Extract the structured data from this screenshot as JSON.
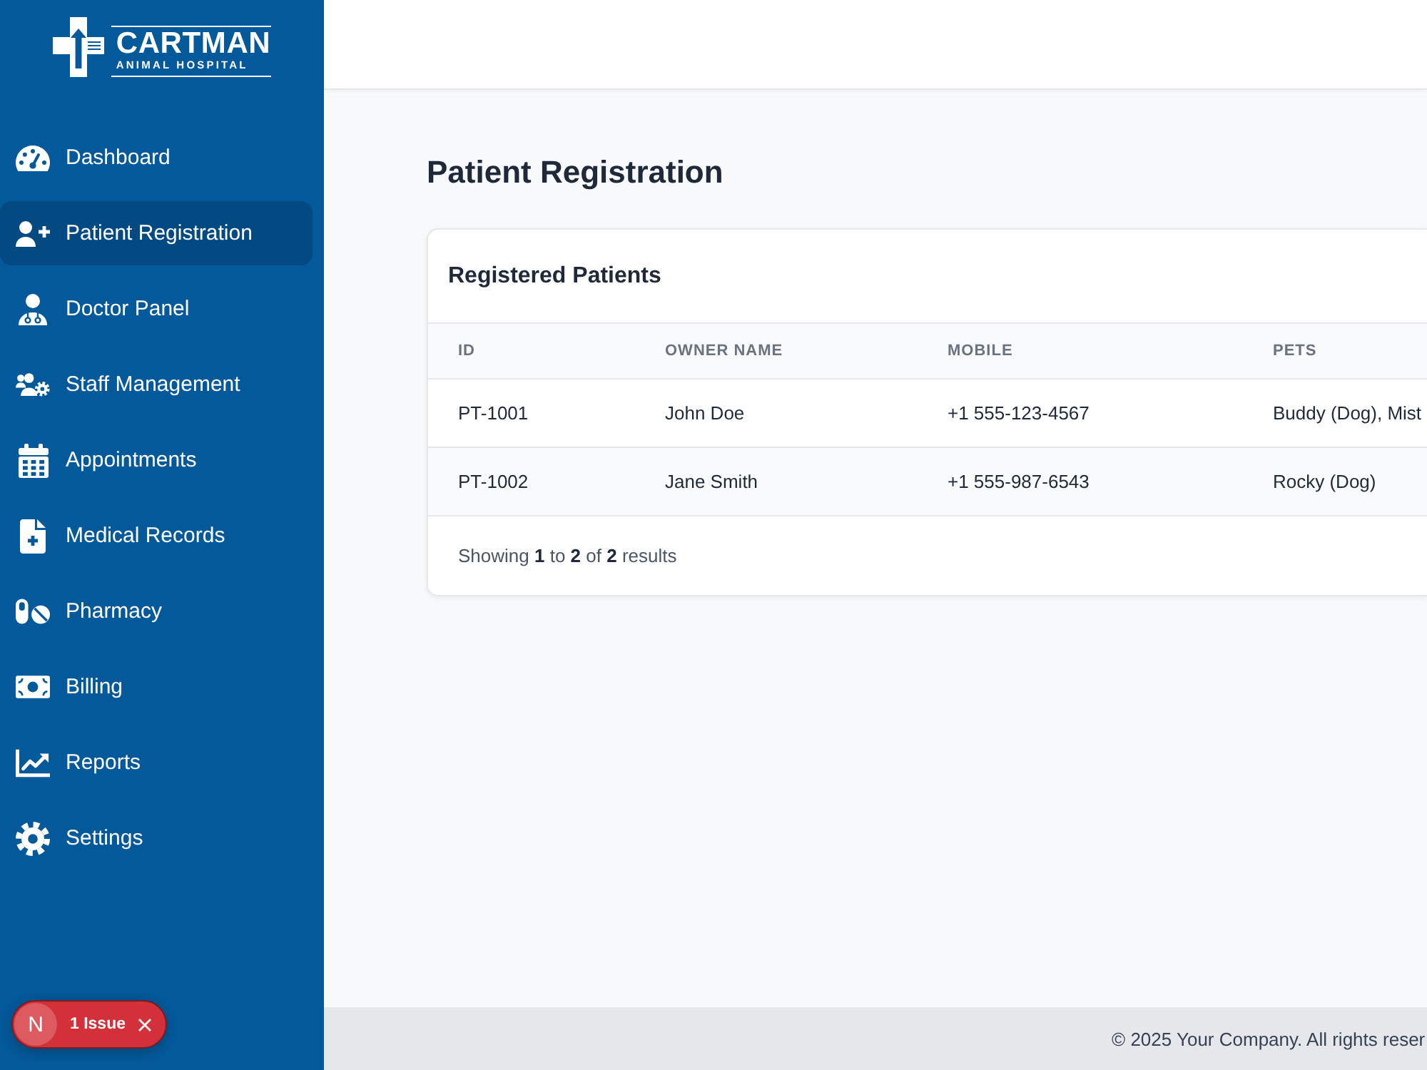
{
  "sidebar": {
    "logo": {
      "title": "CARTMAN",
      "subtitle": "ANIMAL HOSPITAL"
    },
    "items": [
      {
        "label": "Dashboard",
        "selected": false
      },
      {
        "label": "Patient Registration",
        "selected": true
      },
      {
        "label": "Doctor Panel",
        "selected": false
      },
      {
        "label": "Staff Management",
        "selected": false
      },
      {
        "label": "Appointments",
        "selected": false
      },
      {
        "label": "Medical Records",
        "selected": false
      },
      {
        "label": "Pharmacy",
        "selected": false
      },
      {
        "label": "Billing",
        "selected": false
      },
      {
        "label": "Reports",
        "selected": false
      },
      {
        "label": "Settings",
        "selected": false
      }
    ]
  },
  "issue_badge": {
    "letter": "N",
    "label": "1 Issue"
  },
  "page": {
    "title": "Patient Registration"
  },
  "card": {
    "title": "Registered Patients",
    "table": {
      "columns": [
        "ID",
        "OWNER NAME",
        "MOBILE",
        "PETS"
      ],
      "rows": [
        [
          "PT-1001",
          "John Doe",
          "+1 555-123-4567",
          "Buddy (Dog), Mist"
        ],
        [
          "PT-1002",
          "Jane Smith",
          "+1 555-987-6543",
          "Rocky (Dog)"
        ]
      ]
    },
    "summary": "Showing **1** to **2** of **2** results"
  },
  "footer": {
    "text": "© 2025 Your Company. All rights reser"
  }
}
